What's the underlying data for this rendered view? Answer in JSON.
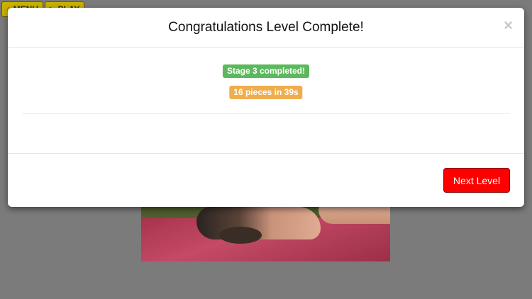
{
  "topbar": {
    "menu_label": "MENU",
    "play_label": "PLAY"
  },
  "modal": {
    "title": "Congratulations Level Complete!",
    "close_symbol": "×",
    "stage_badge": "Stage 3 completed!",
    "stats_badge": "16 pieces in 39s",
    "next_button": "Next Level"
  },
  "colors": {
    "success": "#5cb85c",
    "warning": "#f0ad4e",
    "next_button": "#ff0000"
  },
  "icons": {
    "menu": "home-icon",
    "play": "play-icon",
    "close": "close-icon"
  }
}
